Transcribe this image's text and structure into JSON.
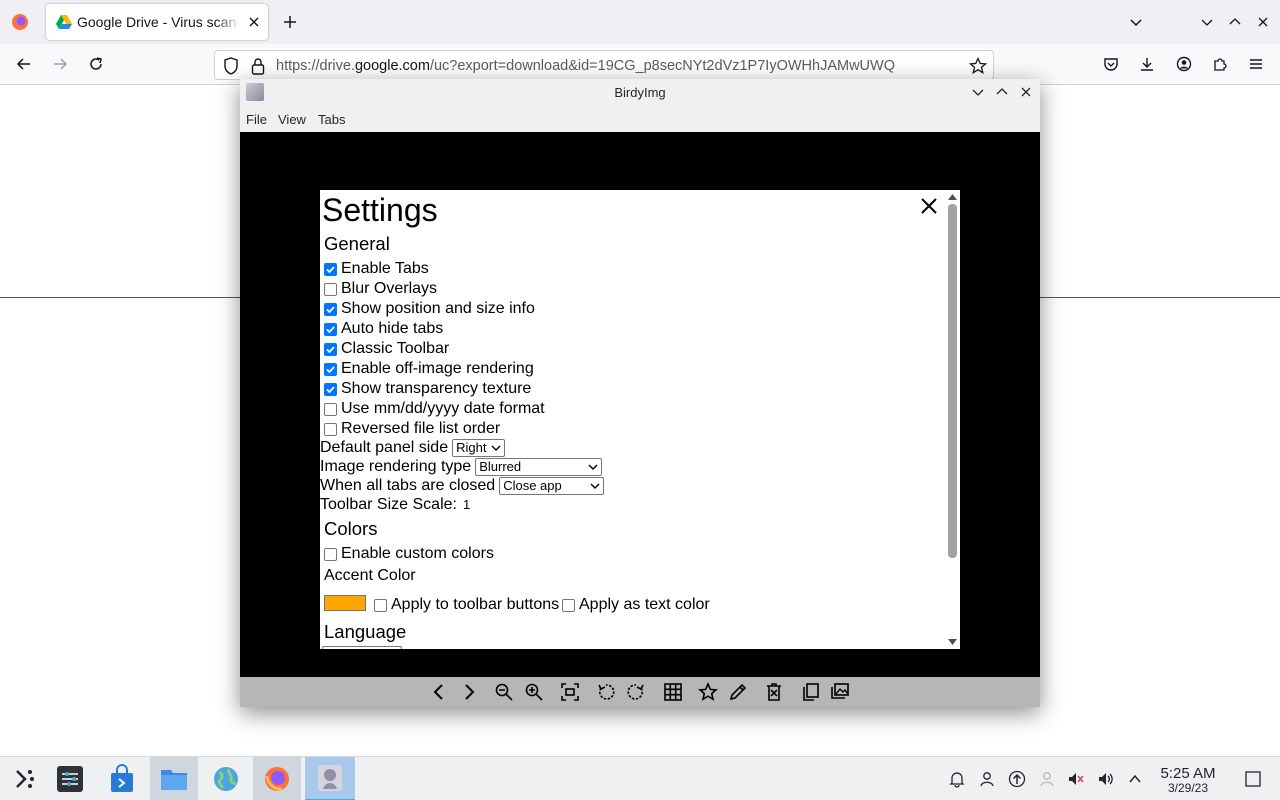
{
  "browser": {
    "tab_title": "Google Drive - Virus scan warning",
    "url_prefix": "https://drive.",
    "url_domain": "google.com",
    "url_path": "/uc?export=download&id=19CG_p8secNYt2dVz1P7IyOWHhJAMwUWQ"
  },
  "app": {
    "title": "BirdyImg",
    "menu": [
      "File",
      "View",
      "Tabs"
    ]
  },
  "settings": {
    "title": "Settings",
    "general_heading": "General",
    "checkboxes": [
      {
        "label": "Enable Tabs",
        "checked": true
      },
      {
        "label": "Blur Overlays",
        "checked": false
      },
      {
        "label": "Show position and size info",
        "checked": true
      },
      {
        "label": "Auto hide tabs",
        "checked": true
      },
      {
        "label": "Classic Toolbar",
        "checked": true
      },
      {
        "label": "Enable off-image rendering",
        "checked": true
      },
      {
        "label": "Show transparency texture",
        "checked": true
      },
      {
        "label": "Use mm/dd/yyyy date format",
        "checked": false
      },
      {
        "label": "Reversed file list order",
        "checked": false
      }
    ],
    "panel_side_label": "Default panel side",
    "panel_side_value": "Right",
    "rendering_label": "Image rendering type",
    "rendering_value": "Blurred",
    "tabs_closed_label": "When all tabs are closed",
    "tabs_closed_value": "Close app",
    "toolbar_scale_label": "Toolbar Size Scale:",
    "toolbar_scale_value": "1",
    "colors_heading": "Colors",
    "custom_colors_label": "Enable custom colors",
    "custom_colors_checked": false,
    "accent_label": "Accent Color",
    "accent_color": "#ffa500",
    "apply_toolbar_label": "Apply to toolbar buttons",
    "apply_text_label": "Apply as text color",
    "language_heading": "Language"
  },
  "taskbar": {
    "time": "5:25 AM",
    "date": "3/29/23"
  }
}
